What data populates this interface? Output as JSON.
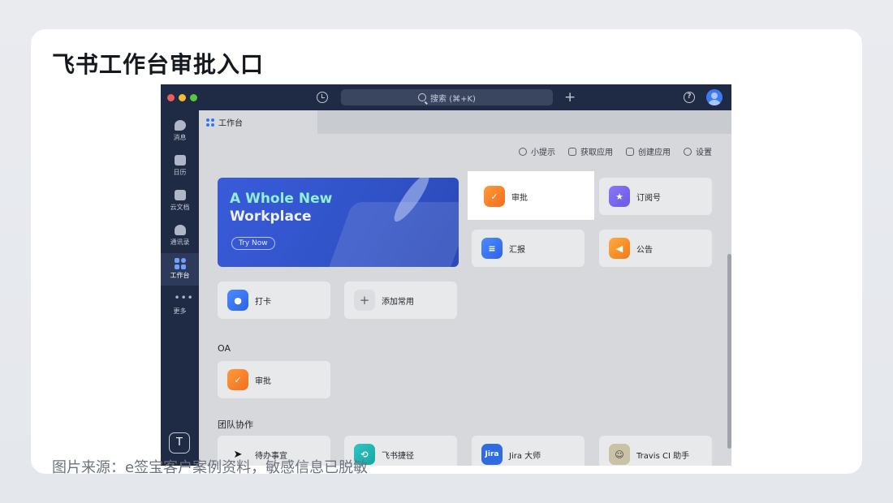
{
  "slide": {
    "title": "飞书工作台审批入口",
    "source_note": "图片来源：e签宝客户案例资料，敏感信息已脱敏"
  },
  "titlebar": {
    "search_label": "搜索 (⌘+K)",
    "plus": "+",
    "help": "?"
  },
  "sidebar": {
    "items": [
      {
        "label": "消息",
        "icon": "chat-bubble-icon"
      },
      {
        "label": "日历",
        "icon": "calendar-icon"
      },
      {
        "label": "云文档",
        "icon": "document-icon"
      },
      {
        "label": "通讯录",
        "icon": "contacts-icon"
      },
      {
        "label": "工作台",
        "icon": "workplace-grid-icon"
      },
      {
        "label": "更多",
        "icon": "more-dots-icon"
      }
    ],
    "user_initial": "T"
  },
  "tab": {
    "label": "工作台"
  },
  "toolbar": {
    "tips": "小提示",
    "get_apps": "获取应用",
    "create_app": "创建应用",
    "settings": "设置"
  },
  "banner": {
    "line1": "A Whole New",
    "line2": "Workplace",
    "button": "Try Now"
  },
  "favorites": {
    "approval": "审批",
    "subscription": "订阅号",
    "report": "汇报",
    "announcement": "公告",
    "checkin": "打卡",
    "add_common": "添加常用"
  },
  "sections": {
    "oa": {
      "title": "OA",
      "approval": "审批"
    },
    "team": {
      "title": "团队协作",
      "todo": "待办事宜",
      "shortcut": "飞书捷径",
      "jira": "Jira 大师",
      "travis": "Travis CI 助手"
    }
  },
  "colors": {
    "titlebar": "#1f2a44",
    "approval_orange": "#f36d1c",
    "banner_blue": "#3153c8",
    "accent_blue": "#3370ff"
  }
}
